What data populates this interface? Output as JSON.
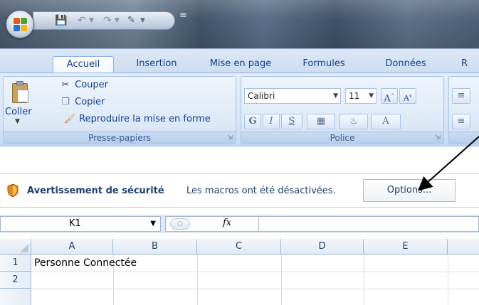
{
  "ribbon_tabs": [
    "Accueil",
    "Insertion",
    "Mise en page",
    "Formules",
    "Données",
    "R"
  ],
  "clipboard": {
    "paste_label": "Coller",
    "cut_label": "Couper",
    "copy_label": "Copier",
    "format_painter_label": "Reproduire la mise en forme",
    "group_label": "Presse-papiers"
  },
  "font": {
    "font_name": "Calibri",
    "font_size": "11",
    "group_label": "Police",
    "bold_label": "G",
    "italic_label": "I",
    "underline_label": "S"
  },
  "security_bar": {
    "title": "Avertissement de sécurité",
    "message": "Les macros ont été désactivées.",
    "options_label": "Options..."
  },
  "formula_bar": {
    "name_box": "K1",
    "fx_label": "fx",
    "formula": ""
  },
  "sheet": {
    "columns": [
      "A",
      "B",
      "C",
      "D",
      "E"
    ],
    "rows": [
      "1",
      "2"
    ],
    "cells": {
      "A1": "Personne Connectée"
    }
  },
  "colors": {
    "ribbon_text": "#15428b",
    "accent_blue": "#8db2e3",
    "shield_orange": "#e8891b"
  },
  "icons": [
    "office-logo-icon",
    "save-icon",
    "undo-icon",
    "redo-icon",
    "customize-icon",
    "paste-icon",
    "cut-icon",
    "copy-icon",
    "format-painter-icon",
    "shield-icon",
    "arrow-annotation"
  ]
}
